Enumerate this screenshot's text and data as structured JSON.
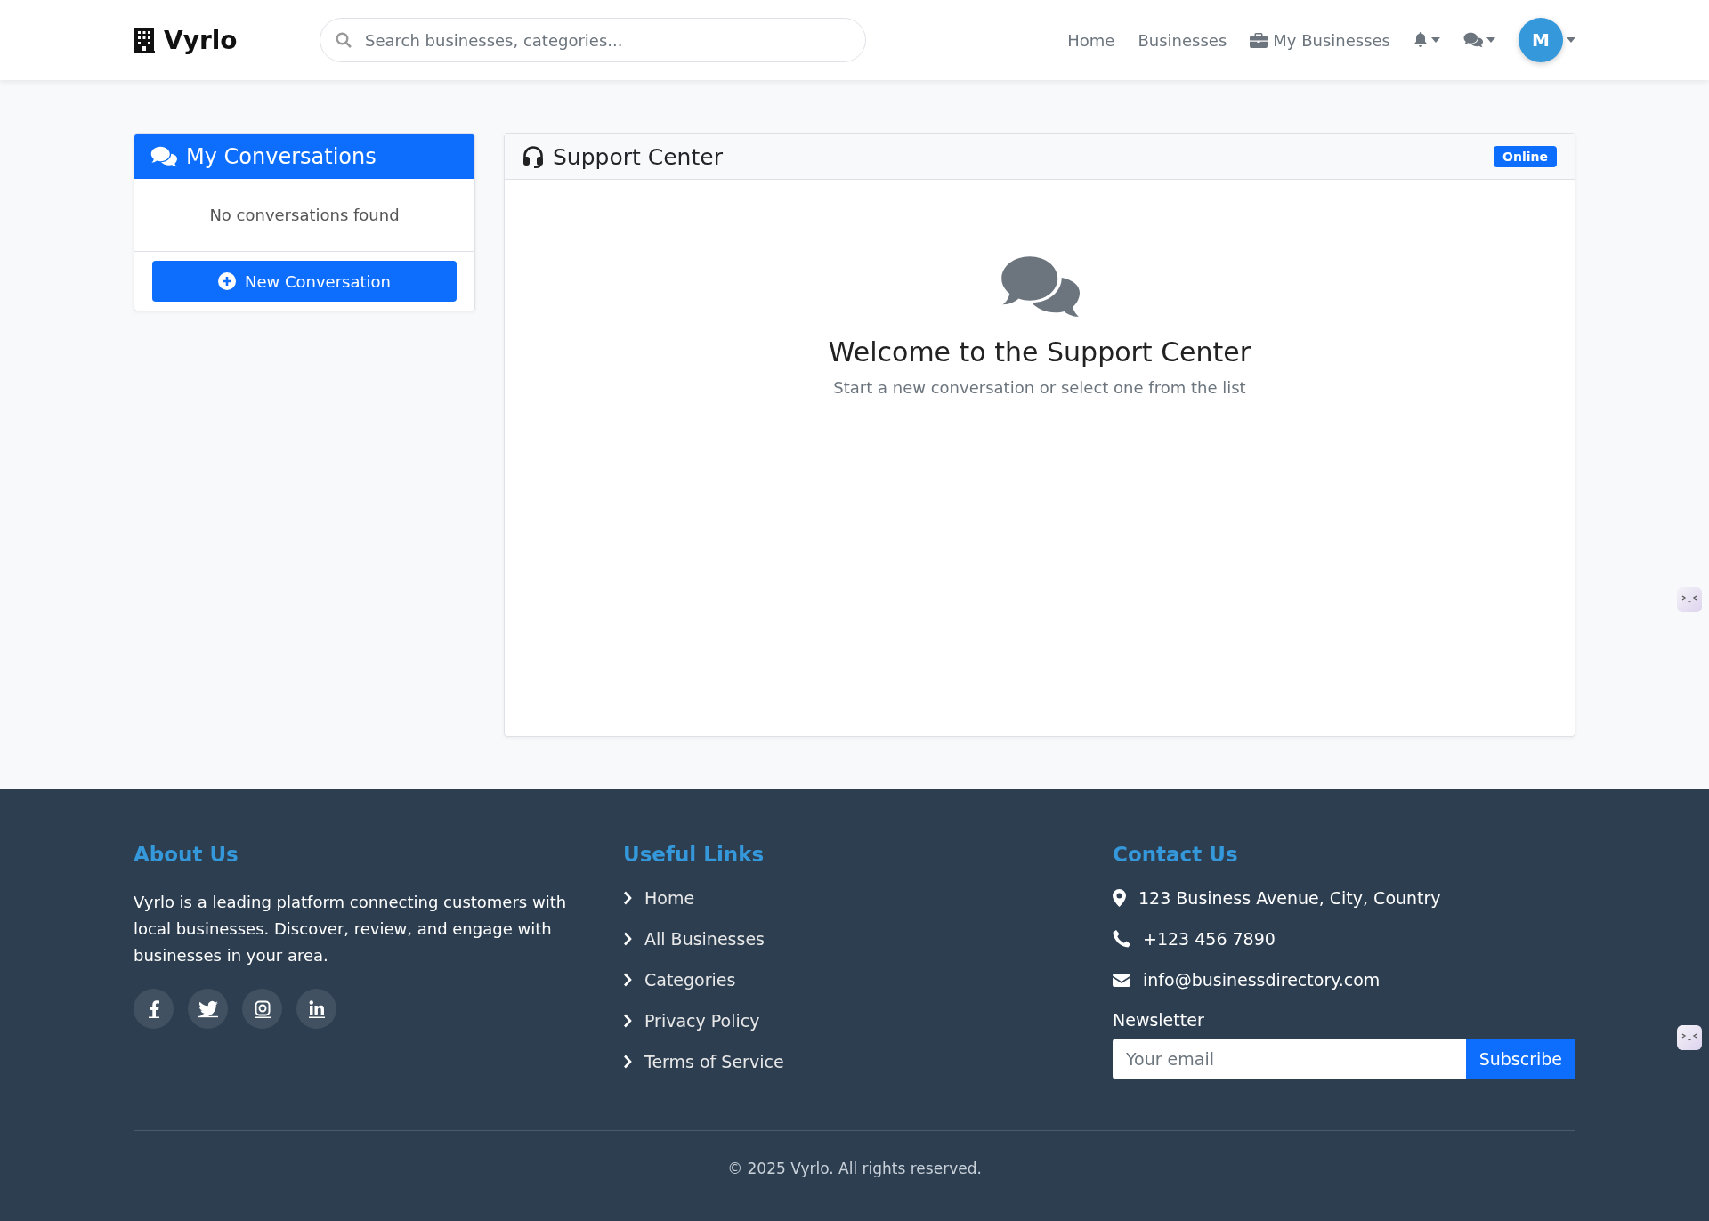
{
  "navbar": {
    "brand": "Vyrlo",
    "search": {
      "placeholder": "Search businesses, categories..."
    },
    "links": [
      {
        "label": "Home",
        "kind": "text"
      },
      {
        "label": "Businesses",
        "kind": "text"
      },
      {
        "label": "My Businesses",
        "kind": "briefcase"
      }
    ],
    "avatar": "M"
  },
  "conversations": {
    "title": "My Conversations",
    "empty": "No conversations found",
    "button": "New Conversation"
  },
  "support": {
    "title": "Support Center",
    "status": "Online",
    "welcome": "Welcome to the Support Center",
    "subtitle": "Start a new conversation or select one from the list"
  },
  "footer": {
    "about": {
      "title": "About Us",
      "text": "Vyrlo is a leading platform connecting customers with local businesses. Discover, review, and engage with businesses in your area.",
      "social": [
        {
          "kind": "facebook"
        },
        {
          "kind": "twitter"
        },
        {
          "kind": "instagram"
        },
        {
          "kind": "linkedin"
        }
      ]
    },
    "links": {
      "title": "Useful Links",
      "items": [
        "Home",
        "All Businesses",
        "Categories",
        "Privacy Policy",
        "Terms of Service"
      ]
    },
    "contact": {
      "title": "Contact Us",
      "items": [
        {
          "kind": "address",
          "text": "123 Business Avenue, City, Country"
        },
        {
          "kind": "phone",
          "text": "+123 456 7890"
        },
        {
          "kind": "email",
          "text": "info@businessdirectory.com"
        }
      ],
      "newsletter": "Newsletter",
      "email_placeholder": "Your email",
      "subscribe": "Subscribe"
    },
    "copyright": "© 2025 Vyrlo. All rights reserved."
  }
}
